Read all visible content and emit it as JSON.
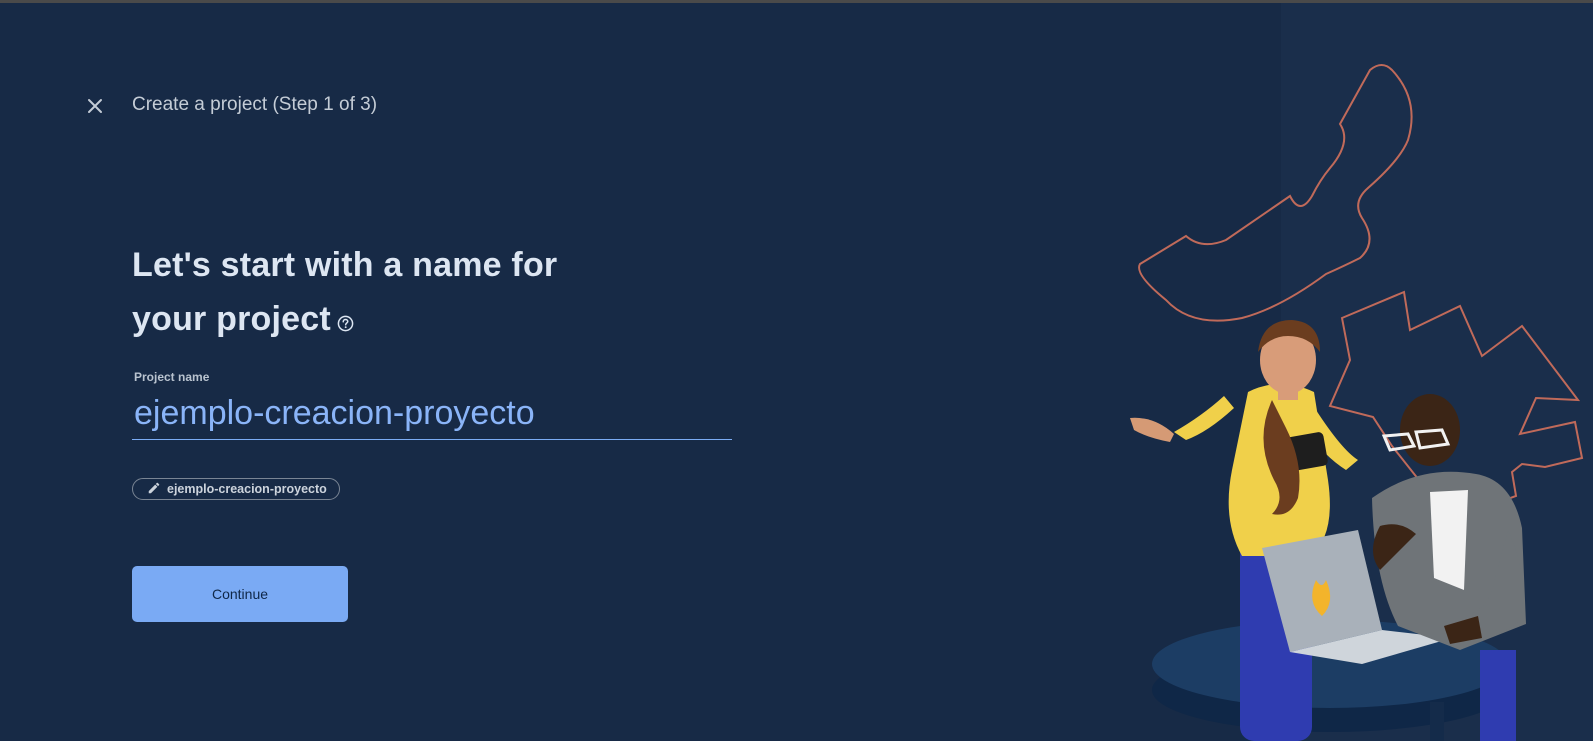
{
  "header": {
    "title": "Create a project (Step 1 of 3)",
    "close_icon": "close-icon"
  },
  "main": {
    "heading_line1": "Let's start with a name for",
    "heading_line2": "your project",
    "help_icon": "help-circle-icon",
    "project_name": {
      "label": "Project name",
      "value": "ejemplo-creacion-proyecto"
    },
    "project_id_chip": {
      "icon": "pencil-icon",
      "value": "ejemplo-creacion-proyecto"
    },
    "continue_label": "Continue"
  },
  "colors": {
    "background": "#172a46",
    "accent": "#8ab4f8",
    "button": "#7aaaf4",
    "decor_outline": "#c06a5a"
  }
}
